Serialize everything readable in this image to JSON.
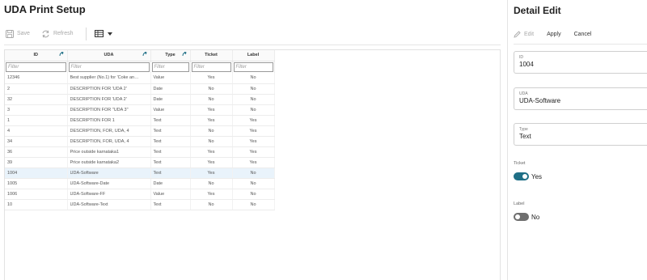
{
  "left_panel": {
    "title": "UDA Print Setup",
    "toolbar": {
      "save_label": "Save",
      "refresh_label": "Refresh"
    },
    "table": {
      "columns": [
        "ID",
        "UDA",
        "Type",
        "Ticket",
        "Label"
      ],
      "filter_placeholder": "Filter",
      "rows": [
        {
          "id": "12346",
          "uda": "Best supplier (No.1) for 'Coke an…",
          "type": "Value",
          "ticket": "Yes",
          "label": "No",
          "selected": false
        },
        {
          "id": "2",
          "uda": "DESCRIPTION FOR 'UDA 2'",
          "type": "Date",
          "ticket": "No",
          "label": "No",
          "selected": false
        },
        {
          "id": "32",
          "uda": "DESCRIPTION FOR 'UDA 2'",
          "type": "Date",
          "ticket": "No",
          "label": "No",
          "selected": false
        },
        {
          "id": "3",
          "uda": "DESCRIPTION FOR \"UDA 3\"",
          "type": "Value",
          "ticket": "Yes",
          "label": "No",
          "selected": false
        },
        {
          "id": "1",
          "uda": "DESCRIPTION FOR 1",
          "type": "Text",
          "ticket": "Yes",
          "label": "Yes",
          "selected": false
        },
        {
          "id": "4",
          "uda": "DESCRIPTION, FOR, UDA, 4",
          "type": "Text",
          "ticket": "No",
          "label": "Yes",
          "selected": false
        },
        {
          "id": "34",
          "uda": "DESCRIPTION, FOR, UDA, 4",
          "type": "Text",
          "ticket": "No",
          "label": "Yes",
          "selected": false
        },
        {
          "id": "36",
          "uda": "Price outside karnataka1",
          "type": "Text",
          "ticket": "Yes",
          "label": "Yes",
          "selected": false
        },
        {
          "id": "39",
          "uda": "Price outside karnataka2",
          "type": "Text",
          "ticket": "Yes",
          "label": "Yes",
          "selected": false
        },
        {
          "id": "1004",
          "uda": "UDA-Software",
          "type": "Text",
          "ticket": "Yes",
          "label": "No",
          "selected": true
        },
        {
          "id": "1005",
          "uda": "UDA-Software-Date",
          "type": "Date",
          "ticket": "No",
          "label": "No",
          "selected": false
        },
        {
          "id": "1006",
          "uda": "UDA-Software-FF",
          "type": "Value",
          "ticket": "Yes",
          "label": "No",
          "selected": false
        },
        {
          "id": "10",
          "uda": "UDA-Software-Text",
          "type": "Text",
          "ticket": "No",
          "label": "No",
          "selected": false
        }
      ]
    }
  },
  "detail": {
    "title": "Detail Edit",
    "toolbar": {
      "edit_label": "Edit",
      "apply_label": "Apply",
      "cancel_label": "Cancel"
    },
    "fields": {
      "id": {
        "label": "ID",
        "value": "1004"
      },
      "uda": {
        "label": "UDA",
        "value": "UDA-Software"
      },
      "type": {
        "label": "Type",
        "value": "Text"
      }
    },
    "ticket": {
      "label": "Ticket",
      "value": "Yes"
    },
    "label": {
      "label": "Label",
      "value": "No"
    }
  },
  "colors": {
    "accent": "#1f6f86",
    "selected_row": "#e9f3fb"
  }
}
